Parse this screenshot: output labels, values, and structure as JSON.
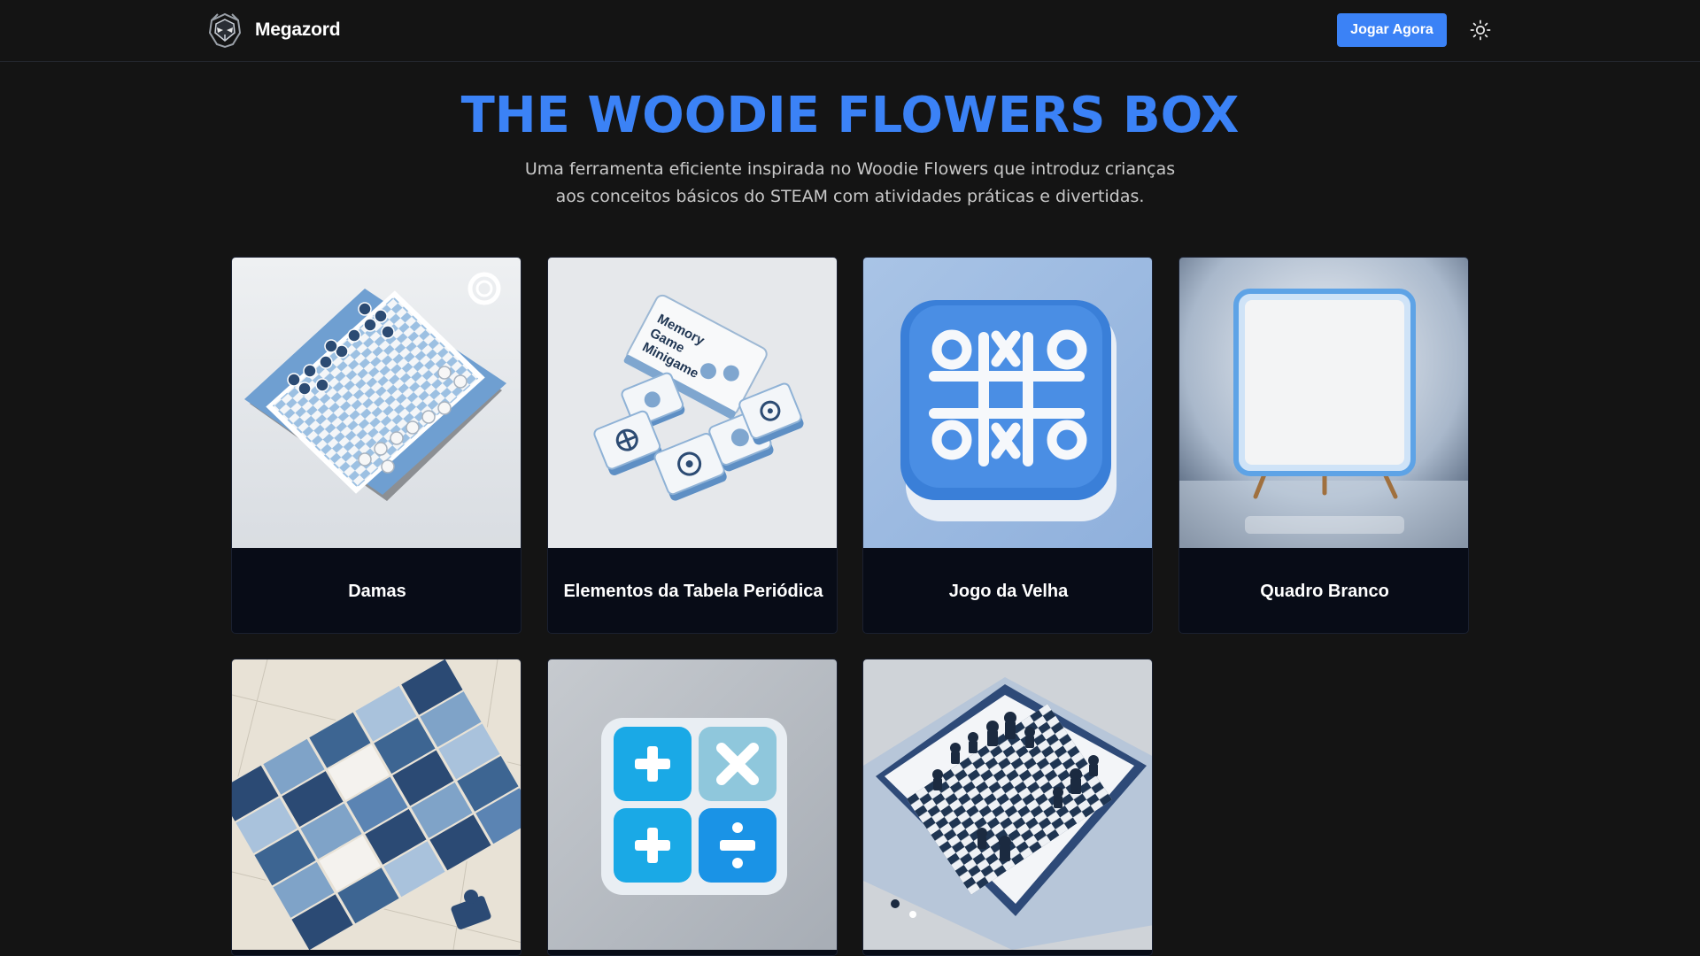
{
  "nav": {
    "brand_name": "Megazord",
    "logo_icon": "robot-head-logo",
    "play_label": "Jogar Agora",
    "theme_icon": "sun-icon"
  },
  "hero": {
    "title": "THE WOODIE FLOWERS BOX",
    "subtitle_line1": "Uma ferramenta eficiente inspirada no Woodie Flowers que introduz crianças",
    "subtitle_line2": "aos conceitos básicos do STEAM com atividades práticas e divertidas."
  },
  "colors": {
    "accent": "#3b82f6",
    "background": "#141414",
    "card_footer": "#080c17"
  },
  "games": [
    {
      "title": "Damas",
      "image": "checkers-board"
    },
    {
      "title": "Elementos da Tabela Periódica",
      "image": "memory-game-cards",
      "image_text_1": "Memory",
      "image_text_2": "Game",
      "image_text_3": "Minigame"
    },
    {
      "title": "Jogo da Velha",
      "image": "tic-tac-toe-board"
    },
    {
      "title": "Quadro Branco",
      "image": "whiteboard"
    },
    {
      "title": "",
      "image": "jigsaw-puzzle"
    },
    {
      "title": "",
      "image": "math-operations-tiles"
    },
    {
      "title": "",
      "image": "chess-board"
    }
  ]
}
